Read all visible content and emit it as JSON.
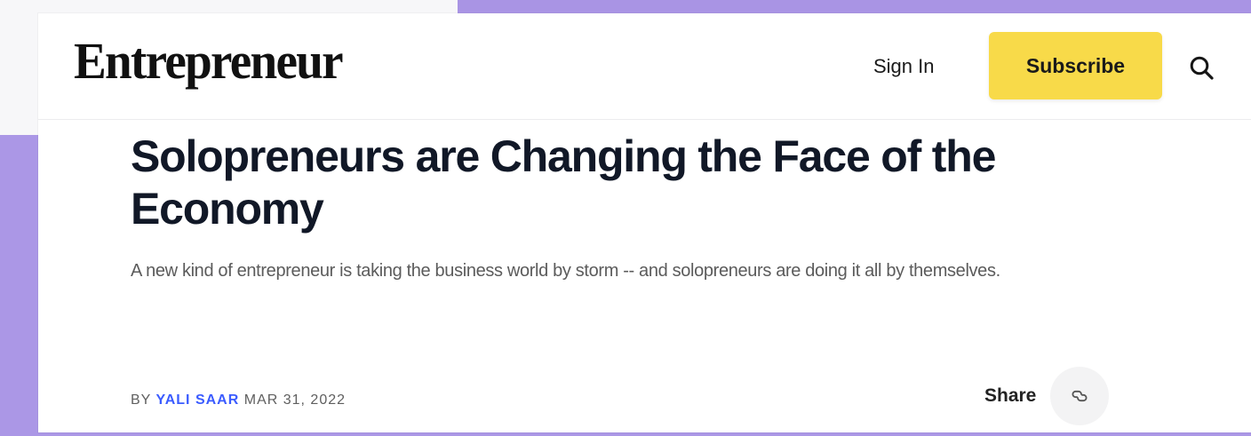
{
  "colors": {
    "page_background": "#ab97e6",
    "accent_yellow": "#f8da49",
    "author_link": "#3b5cff",
    "headline_text": "#111827"
  },
  "header": {
    "logo_text": "Entrepreneur",
    "sign_in_label": "Sign In",
    "subscribe_label": "Subscribe",
    "search_icon": "search-icon"
  },
  "article": {
    "headline": "Solopreneurs are Changing the Face of the Economy",
    "dek": "A new kind of entrepreneur is taking the business world by storm -- and solopreneurs are doing it all by themselves.",
    "byline_prefix": "BY",
    "author": "YALI SAAR",
    "date": "MAR 31, 2022",
    "share_label": "Share",
    "share_icon": "link-icon"
  }
}
